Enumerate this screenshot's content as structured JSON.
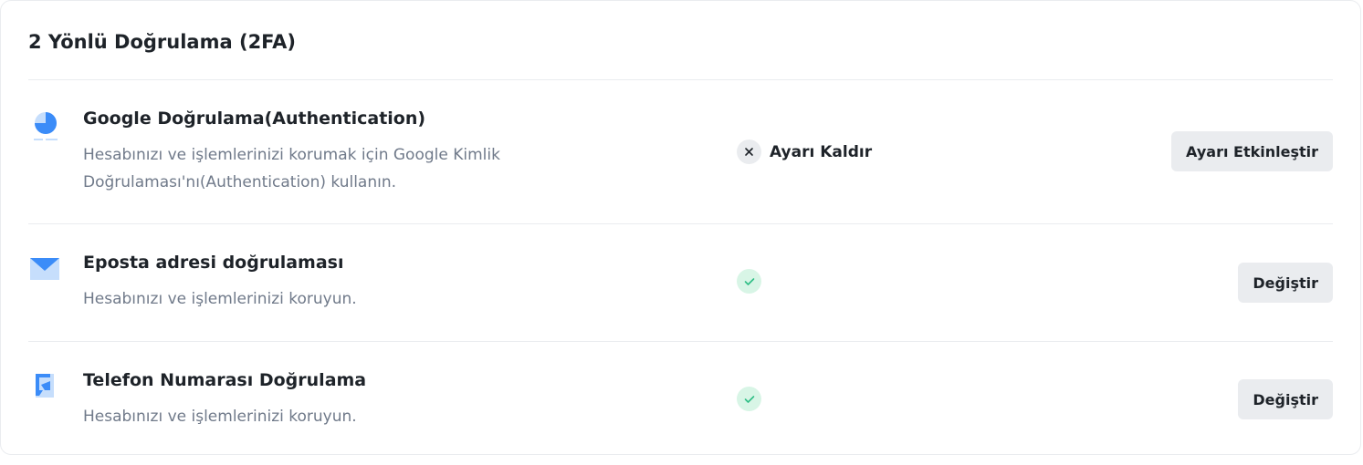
{
  "title": "2 Yönlü Doğrulama (2FA)",
  "methods": [
    {
      "title": "Google Doğrulama(Authentication)",
      "description": "Hesabınızı ve işlemlerinizi korumak için Google Kimlik Doğrulaması'nı(Authentication) kullanın.",
      "icon": "google-authenticator-icon",
      "status_icon": "close-icon",
      "status_text": "Ayarı Kaldır",
      "button_label": "Ayarı Etkinleştir"
    },
    {
      "title": "Eposta adresi doğrulaması",
      "description": "Hesabınızı ve işlemlerinizi koruyun.",
      "icon": "envelope-icon",
      "status_icon": "check-icon",
      "status_text": "",
      "button_label": "Değiştir"
    },
    {
      "title": "Telefon Numarası Doğrulama",
      "description": "Hesabınızı ve işlemlerinizi koruyun.",
      "icon": "phone-message-icon",
      "status_icon": "check-icon",
      "status_text": "",
      "button_label": "Değiştir"
    }
  ],
  "colors": {
    "accent_blue": "#3b8cf8",
    "light_blue": "#c6defc",
    "success_green": "#2ebd85",
    "success_bg": "#d8f5e6",
    "button_bg": "#eaecef",
    "muted_text": "#707a8a"
  }
}
